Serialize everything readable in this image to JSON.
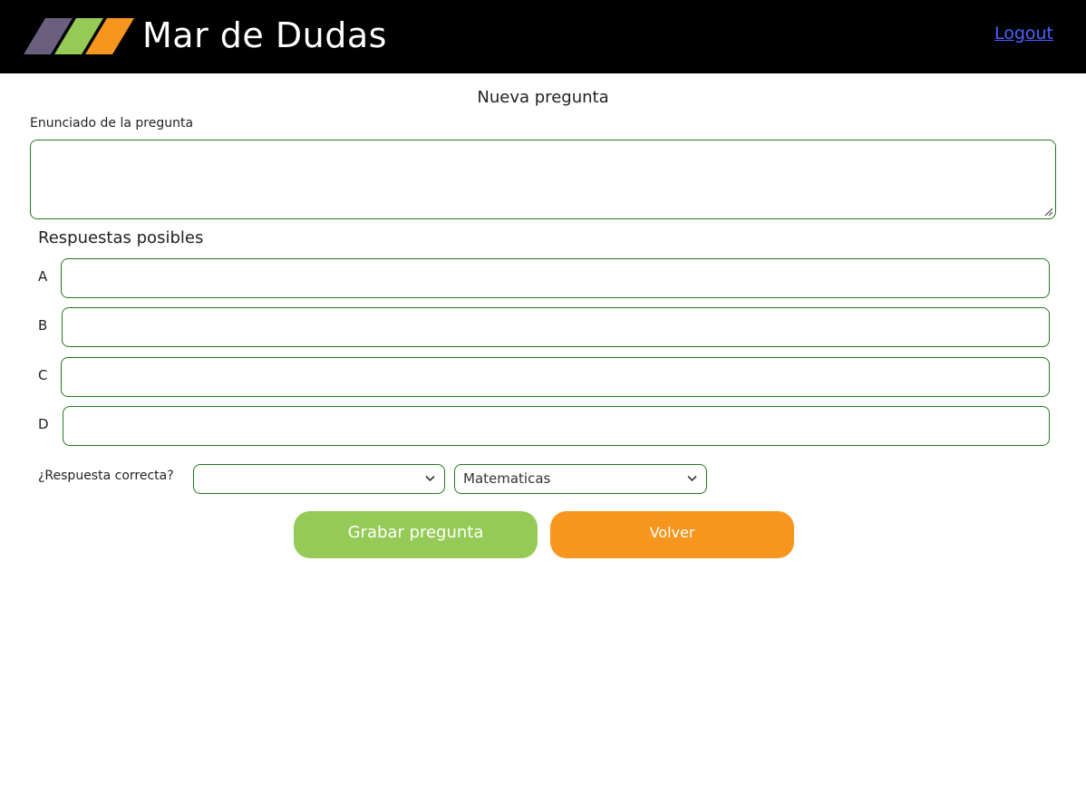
{
  "header": {
    "brand": "Mar de Dudas",
    "logout_label": "Logout",
    "logo_colors": [
      "#6b5f80",
      "#94ca55",
      "#f7961f"
    ]
  },
  "form": {
    "title": "Nueva pregunta",
    "statement_label": "Enunciado de la pregunta",
    "statement_value": "",
    "answers_title": "Respuestas posibles",
    "answers": [
      {
        "letter": "A",
        "value": ""
      },
      {
        "letter": "B",
        "value": ""
      },
      {
        "letter": "C",
        "value": ""
      },
      {
        "letter": "D",
        "value": ""
      }
    ],
    "correct_label": "¿Respuesta correcta?",
    "correct_value": "",
    "subject_value": "Matematicas",
    "save_label": "Grabar pregunta",
    "back_label": "Volver"
  },
  "colors": {
    "header_bg": "#000000",
    "border": "#1f7a1f",
    "save_bg": "#94ca55",
    "back_bg": "#f7961f",
    "link": "#4a63ff"
  },
  "icons": {
    "select_arrow": "chevron-down-icon",
    "resize": "resize-grip-icon"
  }
}
